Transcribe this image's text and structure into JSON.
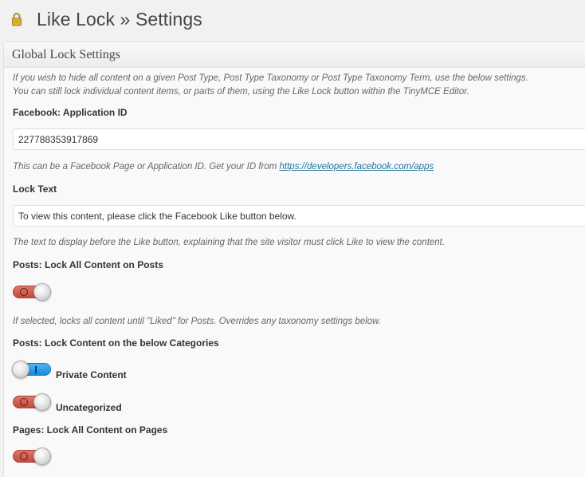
{
  "header": {
    "icon": "lock-icon",
    "title": "Like Lock » Settings"
  },
  "panel": {
    "title": "Global Lock Settings",
    "intro_line1": "If you wish to hide all content on a given Post Type, Post Type Taxonomy or Post Type Taxonomy Term, use the below settings.",
    "intro_line2": "You can still lock individual content items, or parts of them, using the Like Lock button within the TinyMCE Editor."
  },
  "facebook_app_id": {
    "label": "Facebook: Application ID",
    "value": "227788353917869",
    "help_prefix": "This can be a Facebook Page or Application ID. Get your ID from ",
    "help_link": "https://developers.facebook.com/apps"
  },
  "lock_text": {
    "label": "Lock Text",
    "value": "To view this content, please click the Facebook Like button below.",
    "help": "The text to display before the Like button, explaining that the site visitor must click Like to view the content."
  },
  "posts_lock_all": {
    "label": "Posts: Lock All Content on Posts",
    "state": "off",
    "help": "If selected, locks all content until \"Liked\" for Posts. Overrides any taxonomy settings below."
  },
  "posts_categories": {
    "label": "Posts: Lock Content on the below Categories",
    "items": [
      {
        "label": "Private Content",
        "state": "on"
      },
      {
        "label": "Uncategorized",
        "state": "off"
      }
    ]
  },
  "pages_lock_all": {
    "label": "Pages: Lock All Content on Pages",
    "state": "off"
  },
  "colors": {
    "toggle_off": "#c9544a",
    "toggle_on": "#1e8fe0",
    "link": "#21759b"
  }
}
